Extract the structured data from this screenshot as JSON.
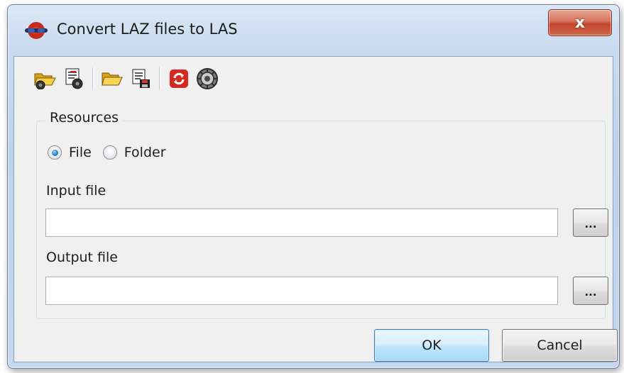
{
  "window": {
    "title": "Convert LAZ files to LAS",
    "close_label": "x"
  },
  "toolbar": {
    "icons": [
      "open-settings-icon",
      "save-settings-icon",
      "open-folder-icon",
      "save-file-icon",
      "refresh-icon",
      "settings-gear-icon"
    ]
  },
  "resources": {
    "group_label": "Resources",
    "options": [
      {
        "label": "File",
        "selected": true
      },
      {
        "label": "Folder",
        "selected": false
      }
    ],
    "input_label": "Input file",
    "input_value": "",
    "output_label": "Output file",
    "output_value": "",
    "browse_label": "..."
  },
  "buttons": {
    "ok": "OK",
    "cancel": "Cancel"
  },
  "colors": {
    "accent_border": "#3c7fb1",
    "close_red": "#c3452c",
    "client_bg": "#f0f0f0"
  }
}
